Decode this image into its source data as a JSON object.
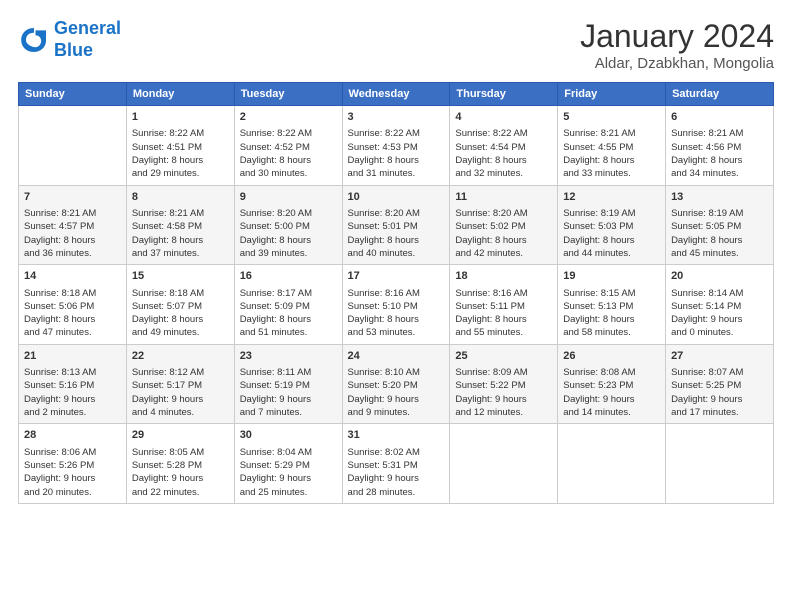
{
  "logo": {
    "line1": "General",
    "line2": "Blue"
  },
  "title": "January 2024",
  "subtitle": "Aldar, Dzabkhan, Mongolia",
  "days_header": [
    "Sunday",
    "Monday",
    "Tuesday",
    "Wednesday",
    "Thursday",
    "Friday",
    "Saturday"
  ],
  "weeks": [
    [
      {
        "day": "",
        "text": ""
      },
      {
        "day": "1",
        "text": "Sunrise: 8:22 AM\nSunset: 4:51 PM\nDaylight: 8 hours\nand 29 minutes."
      },
      {
        "day": "2",
        "text": "Sunrise: 8:22 AM\nSunset: 4:52 PM\nDaylight: 8 hours\nand 30 minutes."
      },
      {
        "day": "3",
        "text": "Sunrise: 8:22 AM\nSunset: 4:53 PM\nDaylight: 8 hours\nand 31 minutes."
      },
      {
        "day": "4",
        "text": "Sunrise: 8:22 AM\nSunset: 4:54 PM\nDaylight: 8 hours\nand 32 minutes."
      },
      {
        "day": "5",
        "text": "Sunrise: 8:21 AM\nSunset: 4:55 PM\nDaylight: 8 hours\nand 33 minutes."
      },
      {
        "day": "6",
        "text": "Sunrise: 8:21 AM\nSunset: 4:56 PM\nDaylight: 8 hours\nand 34 minutes."
      }
    ],
    [
      {
        "day": "7",
        "text": "Sunrise: 8:21 AM\nSunset: 4:57 PM\nDaylight: 8 hours\nand 36 minutes."
      },
      {
        "day": "8",
        "text": "Sunrise: 8:21 AM\nSunset: 4:58 PM\nDaylight: 8 hours\nand 37 minutes."
      },
      {
        "day": "9",
        "text": "Sunrise: 8:20 AM\nSunset: 5:00 PM\nDaylight: 8 hours\nand 39 minutes."
      },
      {
        "day": "10",
        "text": "Sunrise: 8:20 AM\nSunset: 5:01 PM\nDaylight: 8 hours\nand 40 minutes."
      },
      {
        "day": "11",
        "text": "Sunrise: 8:20 AM\nSunset: 5:02 PM\nDaylight: 8 hours\nand 42 minutes."
      },
      {
        "day": "12",
        "text": "Sunrise: 8:19 AM\nSunset: 5:03 PM\nDaylight: 8 hours\nand 44 minutes."
      },
      {
        "day": "13",
        "text": "Sunrise: 8:19 AM\nSunset: 5:05 PM\nDaylight: 8 hours\nand 45 minutes."
      }
    ],
    [
      {
        "day": "14",
        "text": "Sunrise: 8:18 AM\nSunset: 5:06 PM\nDaylight: 8 hours\nand 47 minutes."
      },
      {
        "day": "15",
        "text": "Sunrise: 8:18 AM\nSunset: 5:07 PM\nDaylight: 8 hours\nand 49 minutes."
      },
      {
        "day": "16",
        "text": "Sunrise: 8:17 AM\nSunset: 5:09 PM\nDaylight: 8 hours\nand 51 minutes."
      },
      {
        "day": "17",
        "text": "Sunrise: 8:16 AM\nSunset: 5:10 PM\nDaylight: 8 hours\nand 53 minutes."
      },
      {
        "day": "18",
        "text": "Sunrise: 8:16 AM\nSunset: 5:11 PM\nDaylight: 8 hours\nand 55 minutes."
      },
      {
        "day": "19",
        "text": "Sunrise: 8:15 AM\nSunset: 5:13 PM\nDaylight: 8 hours\nand 58 minutes."
      },
      {
        "day": "20",
        "text": "Sunrise: 8:14 AM\nSunset: 5:14 PM\nDaylight: 9 hours\nand 0 minutes."
      }
    ],
    [
      {
        "day": "21",
        "text": "Sunrise: 8:13 AM\nSunset: 5:16 PM\nDaylight: 9 hours\nand 2 minutes."
      },
      {
        "day": "22",
        "text": "Sunrise: 8:12 AM\nSunset: 5:17 PM\nDaylight: 9 hours\nand 4 minutes."
      },
      {
        "day": "23",
        "text": "Sunrise: 8:11 AM\nSunset: 5:19 PM\nDaylight: 9 hours\nand 7 minutes."
      },
      {
        "day": "24",
        "text": "Sunrise: 8:10 AM\nSunset: 5:20 PM\nDaylight: 9 hours\nand 9 minutes."
      },
      {
        "day": "25",
        "text": "Sunrise: 8:09 AM\nSunset: 5:22 PM\nDaylight: 9 hours\nand 12 minutes."
      },
      {
        "day": "26",
        "text": "Sunrise: 8:08 AM\nSunset: 5:23 PM\nDaylight: 9 hours\nand 14 minutes."
      },
      {
        "day": "27",
        "text": "Sunrise: 8:07 AM\nSunset: 5:25 PM\nDaylight: 9 hours\nand 17 minutes."
      }
    ],
    [
      {
        "day": "28",
        "text": "Sunrise: 8:06 AM\nSunset: 5:26 PM\nDaylight: 9 hours\nand 20 minutes."
      },
      {
        "day": "29",
        "text": "Sunrise: 8:05 AM\nSunset: 5:28 PM\nDaylight: 9 hours\nand 22 minutes."
      },
      {
        "day": "30",
        "text": "Sunrise: 8:04 AM\nSunset: 5:29 PM\nDaylight: 9 hours\nand 25 minutes."
      },
      {
        "day": "31",
        "text": "Sunrise: 8:02 AM\nSunset: 5:31 PM\nDaylight: 9 hours\nand 28 minutes."
      },
      {
        "day": "",
        "text": ""
      },
      {
        "day": "",
        "text": ""
      },
      {
        "day": "",
        "text": ""
      }
    ]
  ]
}
